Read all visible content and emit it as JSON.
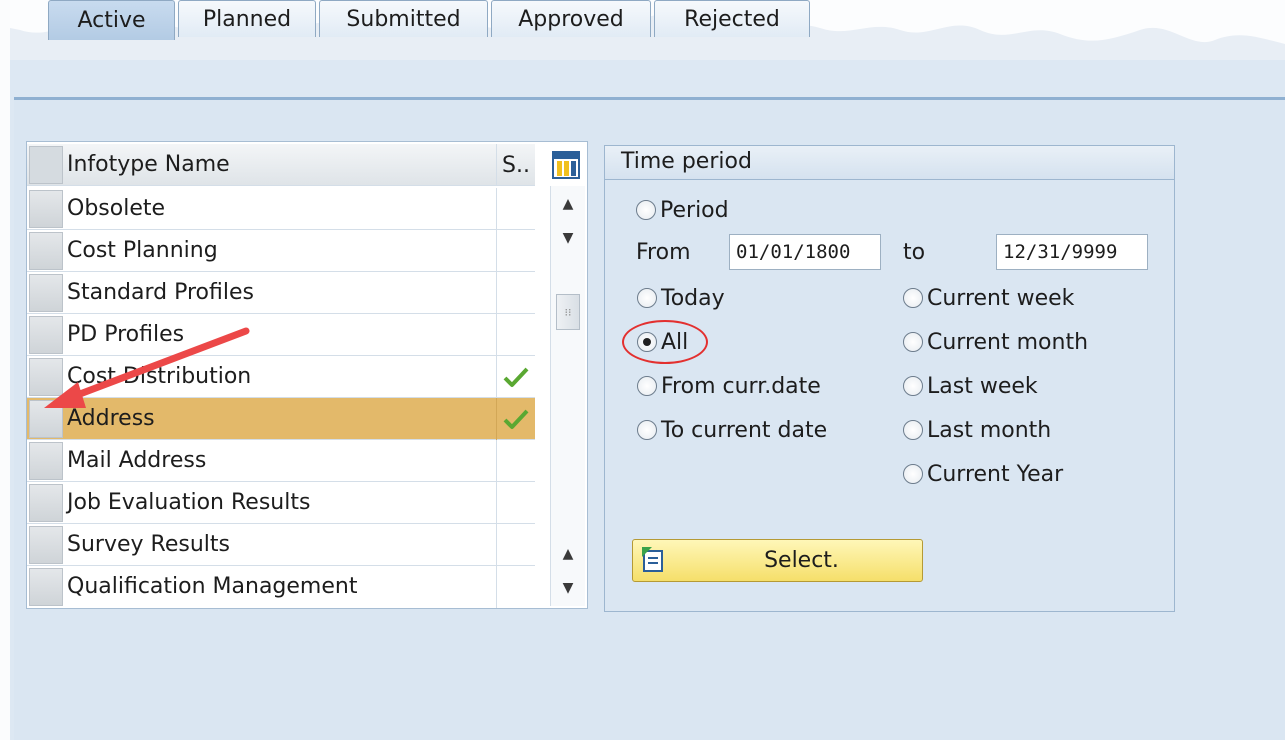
{
  "tabs": [
    {
      "label": "Active",
      "active": true
    },
    {
      "label": "Planned",
      "active": false
    },
    {
      "label": "Submitted",
      "active": false
    },
    {
      "label": "Approved",
      "active": false
    },
    {
      "label": "Rejected",
      "active": false
    }
  ],
  "table": {
    "headers": {
      "name": "Infotype Name",
      "status": "S.."
    },
    "rows": [
      {
        "name": "Obsolete",
        "status": ""
      },
      {
        "name": "Cost Planning",
        "status": ""
      },
      {
        "name": "Standard Profiles",
        "status": ""
      },
      {
        "name": "PD Profiles",
        "status": ""
      },
      {
        "name": "Cost Distribution",
        "status": "check"
      },
      {
        "name": "Address",
        "status": "check",
        "highlighted": true
      },
      {
        "name": "Mail Address",
        "status": ""
      },
      {
        "name": "Job Evaluation Results",
        "status": ""
      },
      {
        "name": "Survey Results",
        "status": ""
      },
      {
        "name": "Qualification Management",
        "status": ""
      }
    ],
    "icons": {
      "column_config": "column-config-icon",
      "status_check": "green-check-icon"
    }
  },
  "time_period": {
    "title": "Time period",
    "period_label": "Period",
    "from_label": "From",
    "from_value": "01/01/1800",
    "to_label": "to",
    "to_value": "12/31/9999",
    "options_left": [
      "Today",
      "All",
      "From curr.date",
      "To current date"
    ],
    "options_right": [
      "Current week",
      "Current month",
      "Last week",
      "Last month",
      "Current Year"
    ],
    "selected": "All",
    "select_button": "Select."
  },
  "colors": {
    "highlight_row": "#e3b96a",
    "annotation_red": "#e3302f",
    "select_button": "#f5df6a",
    "check_green": "#5aa832"
  }
}
